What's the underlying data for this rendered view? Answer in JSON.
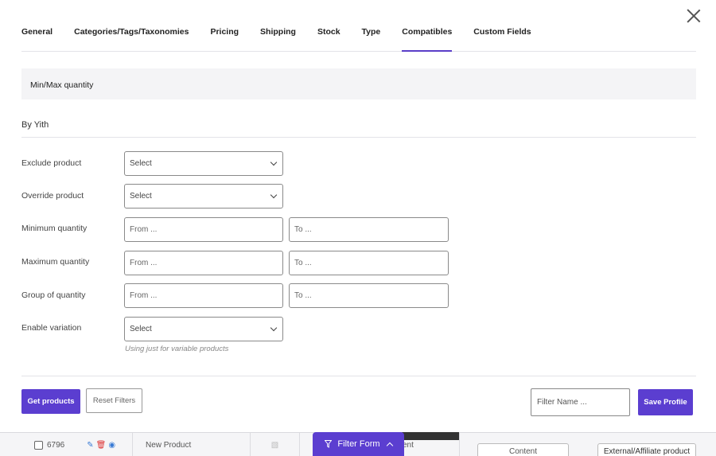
{
  "tabs": [
    {
      "label": "General"
    },
    {
      "label": "Categories/Tags/Taxonomies"
    },
    {
      "label": "Pricing"
    },
    {
      "label": "Shipping"
    },
    {
      "label": "Stock"
    },
    {
      "label": "Type"
    },
    {
      "label": "Compatibles",
      "active": true
    },
    {
      "label": "Custom Fields"
    }
  ],
  "section_title": "Min/Max quantity",
  "subsection_title": "By Yith",
  "fields": {
    "exclude_product": {
      "label": "Exclude product",
      "value": "Select"
    },
    "override_product": {
      "label": "Override product",
      "value": "Select"
    },
    "minimum_quantity": {
      "label": "Minimum quantity",
      "from": "From ...",
      "to": "To ..."
    },
    "maximum_quantity": {
      "label": "Maximum quantity",
      "from": "From ...",
      "to": "To ..."
    },
    "group_of_quantity": {
      "label": "Group of quantity",
      "from": "From ...",
      "to": "To ..."
    },
    "enable_variation": {
      "label": "Enable variation",
      "value": "Select",
      "help": "Using just for variable products"
    }
  },
  "footer": {
    "get_products": "Get products",
    "reset_filters": "Reset Filters",
    "filter_name_placeholder": "Filter Name ...",
    "save_profile": "Save Profile"
  },
  "filter_form_label": "Filter Form",
  "background_row": {
    "id": "6796",
    "title": "New Product",
    "cell_text": "ent",
    "content_label": "Content",
    "type_label": "External/Affiliate product"
  },
  "colors": {
    "accent": "#5b3ed0"
  }
}
